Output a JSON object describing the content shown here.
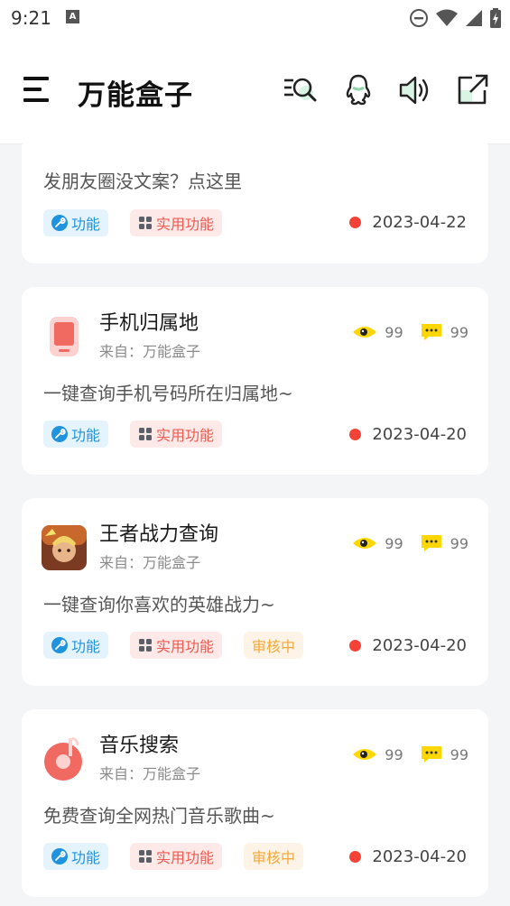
{
  "status_bar": {
    "time": "9:21",
    "notif_letter": "A"
  },
  "app_bar": {
    "title": "万能盒子"
  },
  "cards": [
    {
      "desc": "发朋友圈没文案？点这里",
      "tags": [
        "功能",
        "实用功能"
      ],
      "date": "2023-04-22"
    },
    {
      "name": "手机归属地",
      "from": "来自：万能盒子",
      "views": "99",
      "comments": "99",
      "desc": "一键查询手机号码所在归属地~",
      "tags": [
        "功能",
        "实用功能"
      ],
      "date": "2023-04-20"
    },
    {
      "name": "王者战力查询",
      "from": "来自：万能盒子",
      "views": "99",
      "comments": "99",
      "desc": "一键查询你喜欢的英雄战力~",
      "tags": [
        "功能",
        "实用功能",
        "审核中"
      ],
      "date": "2023-04-20"
    },
    {
      "name": "音乐搜索",
      "from": "来自：万能盒子",
      "views": "99",
      "comments": "99",
      "desc": "免费查询全网热门音乐歌曲~",
      "tags": [
        "功能",
        "实用功能",
        "审核中"
      ],
      "date": "2023-04-20"
    }
  ],
  "icons": [
    "menu-icon",
    "search-icon",
    "qq-icon",
    "volume-icon",
    "share-icon",
    "eye-icon",
    "comment-icon",
    "wrench-icon",
    "grid-icon",
    "phone-icon",
    "game-icon",
    "music-icon"
  ],
  "colors": {
    "tag_func": "#1f93dd",
    "tag_util": "#ee5a4f",
    "tag_review": "#f4a83a",
    "status_dot": "#f44336",
    "stat_yellow": "#ffd700"
  }
}
